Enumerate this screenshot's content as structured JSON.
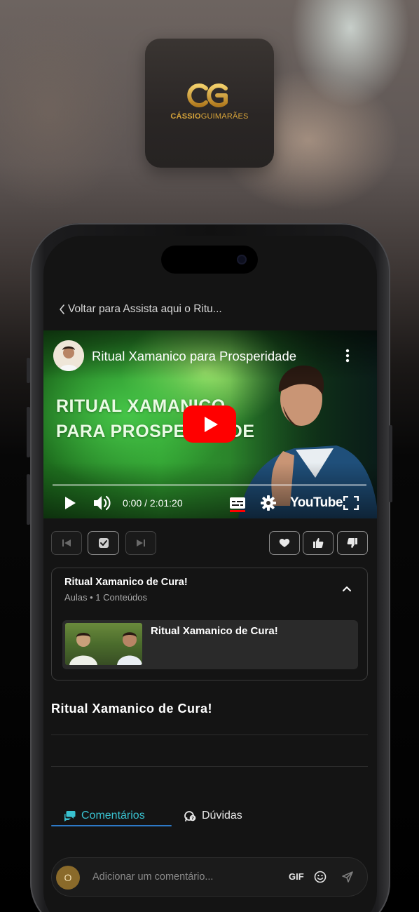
{
  "brand": {
    "name_bold": "CÁSSIO",
    "name_regular": "GUIMARÃES",
    "gold": "#d7a43a"
  },
  "nav": {
    "back_label": "Voltar para Assista aqui o Ritu..."
  },
  "video": {
    "title": "Ritual Xamanico para Prosperidade",
    "overlay_line1": "RITUAL XAMANICO",
    "overlay_line2": "PARA PROSPERIDADE",
    "time": "0:00 / 2:01:20",
    "player_brand": "YouTube",
    "play_color": "#ff0000"
  },
  "module": {
    "title": "Ritual Xamanico de Cura!",
    "subtitle": "Aulas • 1 Conteúdos",
    "lessons": [
      {
        "title": "Ritual Xamanico de Cura!"
      }
    ]
  },
  "lesson": {
    "title": "Ritual Xamanico de Cura!"
  },
  "tabs": [
    {
      "label": "Comentários",
      "active": true,
      "color": "#39c1cf"
    },
    {
      "label": "Dúvidas",
      "active": false,
      "color": "#e8e8e8"
    }
  ],
  "comment": {
    "avatar_initial": "O",
    "placeholder": "Adicionar um comentário...",
    "gif_label": "GIF"
  }
}
